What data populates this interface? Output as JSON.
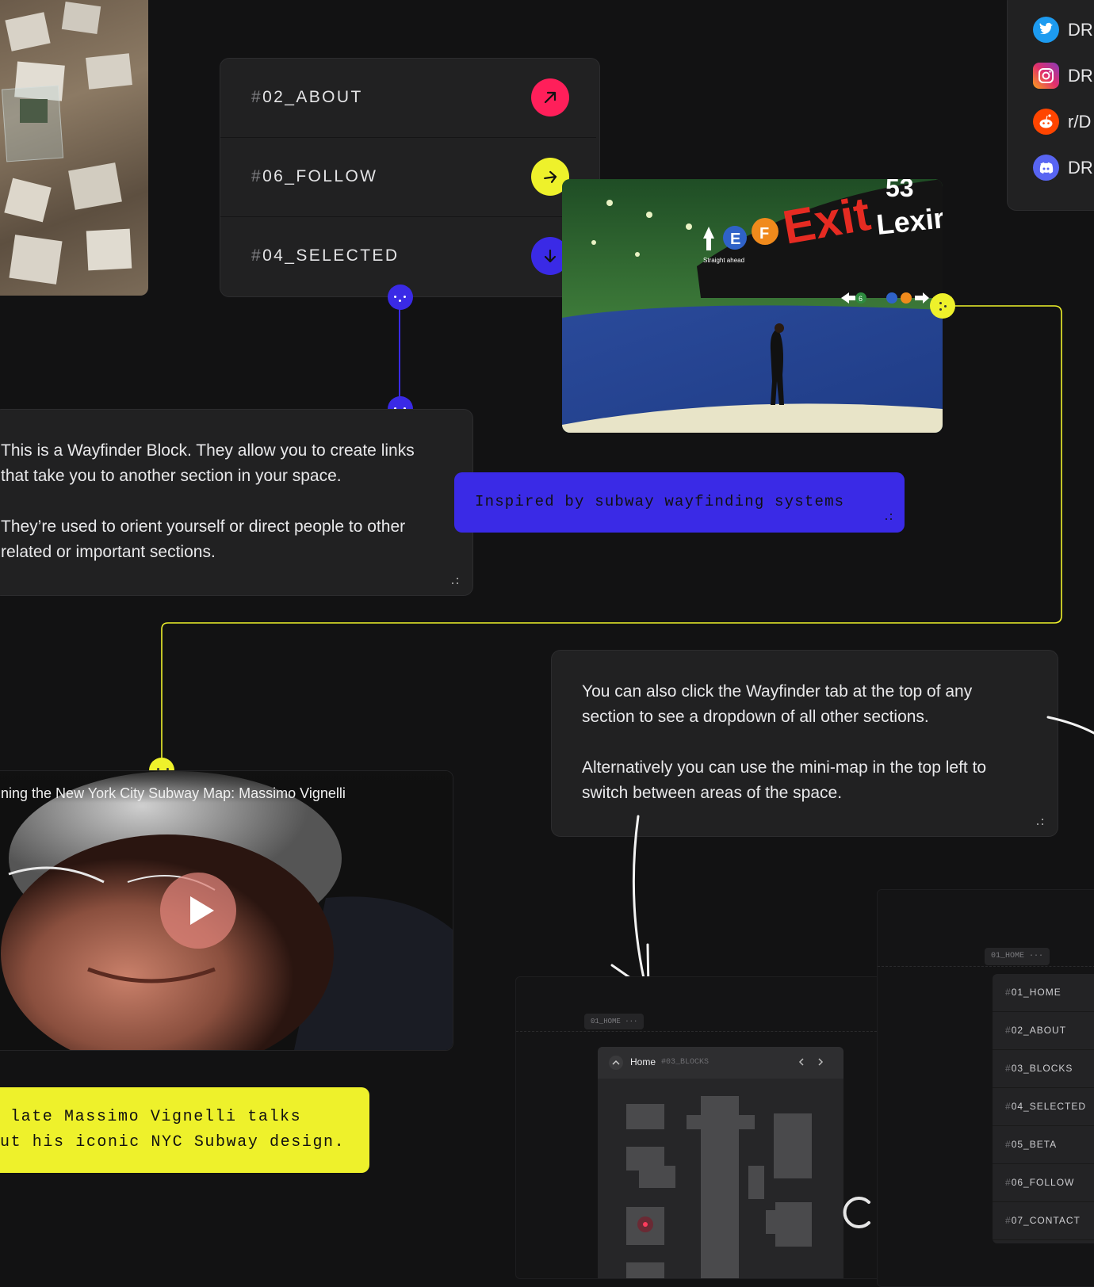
{
  "wayfinder": {
    "items": [
      {
        "hash": "#",
        "label": "02_ABOUT",
        "color": "#ff1f5a",
        "arrow": "arrow-up-right-icon"
      },
      {
        "hash": "#",
        "label": "06_FOLLOW",
        "color": "#eef12b",
        "arrow": "arrow-right-icon"
      },
      {
        "hash": "#",
        "label": "04_SELECTED",
        "color": "#3a2ae6",
        "arrow": "arrow-down-icon"
      }
    ]
  },
  "social": {
    "items": [
      {
        "icon": "twitter-icon",
        "label": "DR",
        "color": "#1d9bf0"
      },
      {
        "icon": "instagram-icon",
        "label": "DR",
        "color": "#e1306c"
      },
      {
        "icon": "reddit-icon",
        "label": "r/D",
        "color": "#ff4500"
      },
      {
        "icon": "discord-icon",
        "label": "DR",
        "color": "#5865f2"
      }
    ]
  },
  "subway_photo": {
    "sign_exit": "Exit",
    "sign_street": "Lexir",
    "sign_number": "53",
    "line_e": "E",
    "line_f": "F",
    "straight_ahead": "Straight ahead",
    "line_6": "6"
  },
  "info_block": {
    "p1": "This is a Wayfinder Block. They allow you to create links that take you to another section in your space.",
    "p2": "They’re used to orient yourself or direct people to other related or important sections."
  },
  "caption_blue": "Inspired by subway wayfinding systems",
  "tip_block": {
    "p1": "You can also click the Wayfinder tab at the top of any section to see a dropdown of all other sections.",
    "p2": "Alternatively you can use the mini-map in the top left to switch between areas of the space."
  },
  "video": {
    "title": "ning the New York City Subway Map: Massimo Vignelli"
  },
  "caption_yellow": {
    "line1": "late Massimo Vignelli talks",
    "line2": "ut his iconic NYC Subway design."
  },
  "minimap_screenshot": {
    "tab": "01_HOME ···",
    "home": "Home",
    "section": "#03_BLOCKS"
  },
  "dropdown_screenshot": {
    "tab": "01_HOME ···",
    "items": [
      {
        "hash": "#",
        "label": "01_HOME"
      },
      {
        "hash": "#",
        "label": "02_ABOUT"
      },
      {
        "hash": "#",
        "label": "03_BLOCKS"
      },
      {
        "hash": "#",
        "label": "04_SELECTED"
      },
      {
        "hash": "#",
        "label": "05_BETA"
      },
      {
        "hash": "#",
        "label": "06_FOLLOW"
      },
      {
        "hash": "#",
        "label": "07_CONTACT"
      }
    ]
  },
  "colors": {
    "accent_blue": "#3a2ae6",
    "accent_yellow": "#eef12b",
    "accent_pink": "#ff1f5a",
    "background": "#121213",
    "card": "#212122"
  }
}
